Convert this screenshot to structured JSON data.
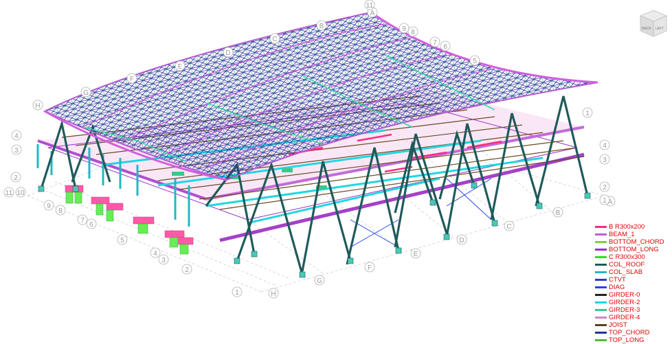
{
  "viewcube": {
    "face_back": "BACK",
    "face_left": "LEFT"
  },
  "grid_labels": {
    "letters": [
      "A",
      "B",
      "C",
      "D",
      "E",
      "F",
      "G",
      "H"
    ],
    "numbers": [
      "1",
      "2",
      "3",
      "4",
      "5",
      "6",
      "7",
      "8",
      "9",
      "10",
      "11"
    ]
  },
  "legend": {
    "text_color": "#e00000",
    "items": [
      {
        "label": "B R300x200",
        "color": "#ff2a7f"
      },
      {
        "label": "BEAM_1",
        "color": "#c658d8"
      },
      {
        "label": "BOTTOM_CHORD",
        "color": "#7cd23a"
      },
      {
        "label": "BOTTOM_LONG",
        "color": "#9b30c8"
      },
      {
        "label": "C R300x300",
        "color": "#33dd22"
      },
      {
        "label": "COL_ROOF",
        "color": "#1f5a5a"
      },
      {
        "label": "COL_SLAB",
        "color": "#21b8c4"
      },
      {
        "label": "CTVT",
        "color": "#2a3fb8"
      },
      {
        "label": "DIAG",
        "color": "#2244ee"
      },
      {
        "label": "GIRDER-0",
        "color": "#222222"
      },
      {
        "label": "GIRDER-2",
        "color": "#18d6e0"
      },
      {
        "label": "GIRDER-3",
        "color": "#3cc88c"
      },
      {
        "label": "GIRDER-4",
        "color": "#c98ac6"
      },
      {
        "label": "JOIST",
        "color": "#5a4020"
      },
      {
        "label": "TOP_CHORD",
        "color": "#223399"
      },
      {
        "label": "TOP_LONG",
        "color": "#4dbb33"
      }
    ]
  }
}
